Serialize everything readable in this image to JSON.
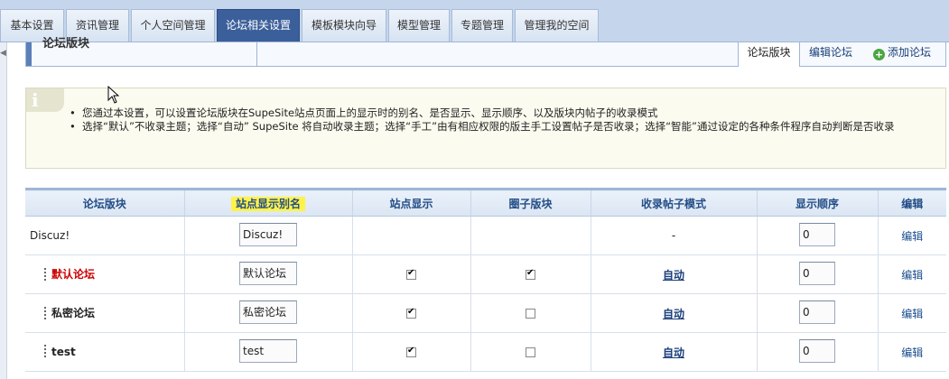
{
  "top_tabs": [
    {
      "label": "基本设置",
      "active": false
    },
    {
      "label": "资讯管理",
      "active": false
    },
    {
      "label": "个人空间管理",
      "active": false
    },
    {
      "label": "论坛相关设置",
      "active": true
    },
    {
      "label": "模板模块向导",
      "active": false
    },
    {
      "label": "模型管理",
      "active": false
    },
    {
      "label": "专题管理",
      "active": false
    },
    {
      "label": "管理我的空间",
      "active": false
    }
  ],
  "section": {
    "title": "论坛版块",
    "tabs": [
      {
        "label": "论坛版块",
        "active": true
      },
      {
        "label": "编辑论坛",
        "active": false
      },
      {
        "label": "添加论坛",
        "active": false,
        "icon": "plus-circle-icon"
      }
    ]
  },
  "info": {
    "icon": "info-bubble-icon",
    "lines": [
      "您通过本设置，可以设置论坛版块在SupeSite站点页面上的显示时的别名、是否显示、显示顺序、以及版块内帖子的收录模式",
      "选择“默认”不收录主题；选择“自动” SupeSite 将自动收录主题；选择“手工”由有相应权限的版主手工设置帖子是否收录；选择“智能”通过设定的各种条件程序自动判断是否收录"
    ]
  },
  "table": {
    "headers": [
      "论坛版块",
      "站点显示别名",
      "站点显示",
      "圈子版块",
      "收录帖子模式",
      "显示顺序",
      "编辑"
    ],
    "highlight_color": "#fff34a",
    "rows": [
      {
        "name": "Discuz!",
        "alias": "Discuz!",
        "show": null,
        "circle": null,
        "mode": "-",
        "order": "0",
        "edit": "编辑",
        "style": "root"
      },
      {
        "name": "默认论坛",
        "alias": "默认论坛",
        "show": true,
        "circle": true,
        "mode": "自动",
        "order": "0",
        "edit": "编辑",
        "style": "red"
      },
      {
        "name": "私密论坛",
        "alias": "私密论坛",
        "show": true,
        "circle": false,
        "mode": "自动",
        "order": "0",
        "edit": "编辑",
        "style": "normal"
      },
      {
        "name": "test",
        "alias": "test",
        "show": true,
        "circle": false,
        "mode": "自动",
        "order": "0",
        "edit": "编辑",
        "style": "normal"
      }
    ]
  }
}
